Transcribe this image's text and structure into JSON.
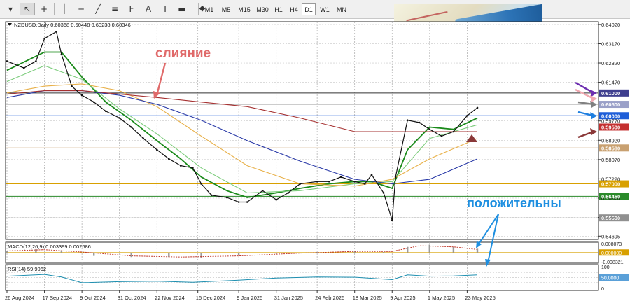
{
  "toolbar": {
    "tools": [
      {
        "name": "menu-icon",
        "glyph": "▾"
      },
      {
        "name": "cursor-icon",
        "glyph": "↖"
      },
      {
        "name": "crosshair-icon",
        "glyph": "+"
      },
      {
        "name": "vertical-line-icon",
        "glyph": "│"
      },
      {
        "name": "horizontal-line-icon",
        "glyph": "─"
      },
      {
        "name": "trendline-icon",
        "glyph": "╱"
      },
      {
        "name": "channel-icon",
        "glyph": "≡"
      },
      {
        "name": "fibonacci-icon",
        "glyph": "F"
      },
      {
        "name": "text-icon",
        "glyph": "A"
      },
      {
        "name": "label-icon",
        "glyph": "T"
      },
      {
        "name": "shapes-icon",
        "glyph": "▬"
      },
      {
        "name": "arrows-icon",
        "glyph": "⯁"
      }
    ],
    "timeframes": [
      "M1",
      "M5",
      "M15",
      "M30",
      "H1",
      "H4",
      "D1",
      "W1",
      "MN"
    ],
    "active_timeframe": "D1"
  },
  "chart_data": {
    "type": "line",
    "title": "NZDUSD,Daily  0.60368 0.60448 0.60238 0.60346",
    "symbol": "NZDUSD",
    "timeframe": "Daily",
    "ohlc": {
      "open": 0.60368,
      "high": 0.60448,
      "low": 0.60238,
      "close": 0.60346
    },
    "x_tick_labels": [
      "26 Aug 2024",
      "17 Sep 2024",
      "9 Oct 2024",
      "31 Oct 2024",
      "22 Nov 2024",
      "16 Dec 2024",
      "9 Jan 2025",
      "31 Jan 2025",
      "24 Feb 2025",
      "18 Mar 2025",
      "9 Apr 2025",
      "1 May 2025",
      "23 May 2025"
    ],
    "y_tick_labels": [
      "0.64020",
      "0.63170",
      "0.62320",
      "0.61470",
      "0.59770",
      "0.58920",
      "0.58070",
      "0.57220",
      "0.56370",
      "0.55520",
      "0.54695"
    ],
    "ylim": [
      0.5455,
      0.6414
    ],
    "grid": true,
    "price_series": {
      "name": "NZDUSD",
      "x": [
        "2024-08-26",
        "2024-09-05",
        "2024-09-12",
        "2024-09-17",
        "2024-09-24",
        "2024-09-27",
        "2024-10-03",
        "2024-10-09",
        "2024-10-16",
        "2024-10-23",
        "2024-10-31",
        "2024-11-07",
        "2024-11-14",
        "2024-11-22",
        "2024-11-29",
        "2024-12-06",
        "2024-12-13",
        "2024-12-18",
        "2024-12-24",
        "2025-01-02",
        "2025-01-09",
        "2025-01-14",
        "2025-01-23",
        "2025-01-31",
        "2025-02-07",
        "2025-02-14",
        "2025-02-24",
        "2025-03-03",
        "2025-03-10",
        "2025-03-18",
        "2025-03-24",
        "2025-03-28",
        "2025-04-04",
        "2025-04-09",
        "2025-04-11",
        "2025-04-18",
        "2025-04-25",
        "2025-05-01",
        "2025-05-08",
        "2025-05-15",
        "2025-05-23",
        "2025-05-29"
      ],
      "y": [
        0.624,
        0.621,
        0.624,
        0.634,
        0.637,
        0.627,
        0.613,
        0.609,
        0.606,
        0.602,
        0.599,
        0.595,
        0.59,
        0.585,
        0.581,
        0.578,
        0.577,
        0.57,
        0.565,
        0.564,
        0.562,
        0.562,
        0.567,
        0.563,
        0.566,
        0.57,
        0.571,
        0.571,
        0.573,
        0.571,
        0.57,
        0.574,
        0.566,
        0.554,
        0.573,
        0.598,
        0.597,
        0.594,
        0.591,
        0.593,
        0.6,
        0.6035
      ]
    },
    "series": [
      {
        "name": "",
        "color": "#1a8a1a",
        "x": [
          "2024-08-26",
          "2024-09-17",
          "2024-09-27",
          "2024-10-09",
          "2024-10-23",
          "2024-11-07",
          "2024-11-22",
          "2024-12-06",
          "2024-12-18",
          "2025-01-02",
          "2025-01-14",
          "2025-01-31",
          "2025-02-14",
          "2025-03-03",
          "2025-03-18",
          "2025-03-28",
          "2025-04-09",
          "2025-04-18",
          "2025-05-01",
          "2025-05-15",
          "2025-05-29"
        ],
        "y": [
          0.62,
          0.628,
          0.628,
          0.617,
          0.606,
          0.598,
          0.589,
          0.581,
          0.573,
          0.567,
          0.564,
          0.566,
          0.568,
          0.57,
          0.571,
          0.571,
          0.568,
          0.585,
          0.595,
          0.594,
          0.599
        ]
      },
      {
        "name": "",
        "color": "#7ccc7c",
        "x": [
          "2024-08-26",
          "2024-09-17",
          "2024-10-09",
          "2024-10-31",
          "2024-11-22",
          "2024-12-18",
          "2025-01-14",
          "2025-02-14",
          "2025-03-18",
          "2025-04-09",
          "2025-05-01",
          "2025-05-29"
        ],
        "y": [
          0.615,
          0.622,
          0.616,
          0.603,
          0.592,
          0.577,
          0.566,
          0.567,
          0.57,
          0.571,
          0.59,
          0.596
        ]
      },
      {
        "name": "",
        "color": "#e8b048",
        "x": [
          "2024-08-26",
          "2024-09-17",
          "2024-10-09",
          "2024-10-31",
          "2024-11-22",
          "2024-12-18",
          "2025-01-14",
          "2025-02-14",
          "2025-03-18",
          "2025-04-09",
          "2025-05-01",
          "2025-05-29"
        ],
        "y": [
          0.61,
          0.613,
          0.614,
          0.611,
          0.604,
          0.591,
          0.578,
          0.57,
          0.569,
          0.572,
          0.581,
          0.59
        ]
      },
      {
        "name": "",
        "color": "#2b3ba8",
        "x": [
          "2024-08-26",
          "2024-09-17",
          "2024-10-09",
          "2024-10-31",
          "2024-11-22",
          "2024-12-18",
          "2025-01-14",
          "2025-02-14",
          "2025-03-18",
          "2025-04-09",
          "2025-05-01",
          "2025-05-29"
        ],
        "y": [
          0.608,
          0.611,
          0.611,
          0.609,
          0.605,
          0.598,
          0.589,
          0.58,
          0.572,
          0.57,
          0.572,
          0.581
        ]
      },
      {
        "name": "",
        "color": "#a53030",
        "x": [
          "2024-08-26",
          "2024-09-17",
          "2024-10-09",
          "2024-11-22",
          "2024-12-18",
          "2025-01-14",
          "2025-02-14",
          "2025-03-18",
          "2025-04-09",
          "2025-04-18",
          "2025-05-29"
        ],
        "y": [
          0.6095,
          0.611,
          0.611,
          0.608,
          0.606,
          0.604,
          0.599,
          0.593,
          0.593,
          0.593,
          0.593
        ]
      }
    ],
    "levels": [
      {
        "value": 0.61,
        "label": "0.61000",
        "color": "#3e3e8e",
        "line": "#333333"
      },
      {
        "value": 0.605,
        "label": "0.60500",
        "color": "#9aa0c8",
        "line": "#999999"
      },
      {
        "value": 0.6,
        "label": "0.60000",
        "color": "#1e5ed8",
        "line": "#1e5ed8"
      },
      {
        "value": 0.595,
        "label": "0.59500",
        "color": "#c43030",
        "line": "#c43030"
      },
      {
        "value": 0.5858,
        "label": "0.58580",
        "color": "#c8a070",
        "line": "#c8a070"
      },
      {
        "value": 0.57,
        "label": "0.57000",
        "color": "#d8a000",
        "line": "#d8a000"
      },
      {
        "value": 0.5645,
        "label": "0.56450",
        "color": "#2a8a2a",
        "line": "#2a8a2a"
      },
      {
        "value": 0.555,
        "label": "0.55500",
        "color": "#909090",
        "line": "#b0b0b0"
      }
    ],
    "annotations": [
      {
        "text": "слияние",
        "color": "#e06a6a"
      },
      {
        "text": "положительны",
        "color": "#1e8fe0"
      }
    ],
    "macd": {
      "title": "MACD(12,26,9) 0.003399 0.002686",
      "params": [
        12,
        26,
        9
      ],
      "main": 0.003399,
      "signal": 0.002686,
      "y_tick_labels": [
        "0.008073",
        "0.000000",
        "-0.008321"
      ],
      "ylim": [
        -0.0095,
        0.0092
      ],
      "bars_x": [
        "2024-08-26",
        "2024-09-12",
        "2024-09-27",
        "2024-10-16",
        "2024-11-07",
        "2024-11-29",
        "2024-12-18",
        "2025-01-09",
        "2025-01-31",
        "2025-02-24",
        "2025-03-18",
        "2025-04-04",
        "2025-04-18",
        "2025-05-01",
        "2025-05-15",
        "2025-05-29"
      ],
      "bars_y": [
        0.0015,
        0.003,
        0.002,
        -0.003,
        -0.004,
        -0.004,
        -0.0045,
        -0.0025,
        -0.001,
        0.0005,
        0.001,
        0.0005,
        0.005,
        0.007,
        0.005,
        0.0034
      ],
      "signal_x": [
        "2024-08-26",
        "2024-09-17",
        "2024-10-09",
        "2024-11-07",
        "2024-12-06",
        "2025-01-09",
        "2025-02-14",
        "2025-03-18",
        "2025-04-09",
        "2025-04-25",
        "2025-05-15",
        "2025-05-29"
      ],
      "signal_y": [
        0.0015,
        0.0025,
        0.0005,
        -0.003,
        -0.004,
        -0.003,
        -0.0005,
        0.001,
        0.001,
        0.006,
        0.005,
        0.0027
      ]
    },
    "rsi": {
      "title": "RSI(14) 59.9062",
      "period": 14,
      "value": 59.9062,
      "y_tick_labels": [
        "100",
        "70",
        "50",
        "30",
        "0"
      ],
      "ylim": [
        0,
        100
      ],
      "x": [
        "2024-08-26",
        "2024-09-17",
        "2024-09-27",
        "2024-10-09",
        "2024-10-31",
        "2024-11-22",
        "2024-12-13",
        "2025-01-09",
        "2025-01-31",
        "2025-02-24",
        "2025-03-18",
        "2025-04-09",
        "2025-04-18",
        "2025-05-01",
        "2025-05-15",
        "2025-05-29"
      ],
      "y": [
        55,
        62,
        52,
        30,
        34,
        36,
        32,
        40,
        48,
        52,
        51,
        42,
        60,
        55,
        56,
        59.9
      ]
    }
  }
}
